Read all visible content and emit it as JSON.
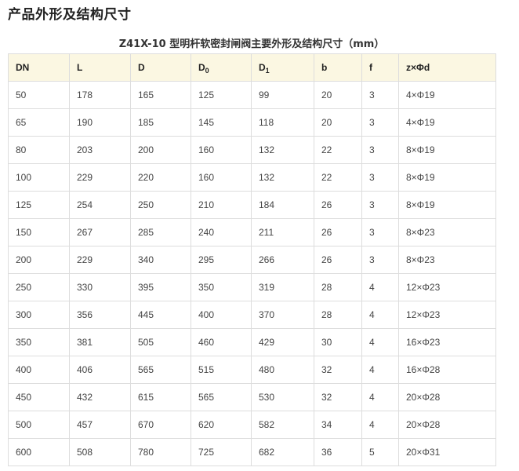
{
  "page": {
    "title": "产品外形及结构尺寸",
    "caption": "Z41X-10 型明杆软密封闸阀主要外形及结构尺寸（mm）"
  },
  "table": {
    "headers": [
      {
        "main": "DN",
        "sub": ""
      },
      {
        "main": "L",
        "sub": ""
      },
      {
        "main": "D",
        "sub": ""
      },
      {
        "main": "D",
        "sub": "0"
      },
      {
        "main": "D",
        "sub": "1"
      },
      {
        "main": "b",
        "sub": ""
      },
      {
        "main": "f",
        "sub": ""
      },
      {
        "main": "z×Φd",
        "sub": ""
      }
    ],
    "rows": [
      [
        "50",
        "178",
        "165",
        "125",
        "99",
        "20",
        "3",
        "4×Φ19"
      ],
      [
        "65",
        "190",
        "185",
        "145",
        "118",
        "20",
        "3",
        "4×Φ19"
      ],
      [
        "80",
        "203",
        "200",
        "160",
        "132",
        "22",
        "3",
        "8×Φ19"
      ],
      [
        "100",
        "229",
        "220",
        "160",
        "132",
        "22",
        "3",
        "8×Φ19"
      ],
      [
        "125",
        "254",
        "250",
        "210",
        "184",
        "26",
        "3",
        "8×Φ19"
      ],
      [
        "150",
        "267",
        "285",
        "240",
        "211",
        "26",
        "3",
        "8×Φ23"
      ],
      [
        "200",
        "229",
        "340",
        "295",
        "266",
        "26",
        "3",
        "8×Φ23"
      ],
      [
        "250",
        "330",
        "395",
        "350",
        "319",
        "28",
        "4",
        "12×Φ23"
      ],
      [
        "300",
        "356",
        "445",
        "400",
        "370",
        "28",
        "4",
        "12×Φ23"
      ],
      [
        "350",
        "381",
        "505",
        "460",
        "429",
        "30",
        "4",
        "16×Φ23"
      ],
      [
        "400",
        "406",
        "565",
        "515",
        "480",
        "32",
        "4",
        "16×Φ28"
      ],
      [
        "450",
        "432",
        "615",
        "565",
        "530",
        "32",
        "4",
        "20×Φ28"
      ],
      [
        "500",
        "457",
        "670",
        "620",
        "582",
        "34",
        "4",
        "20×Φ28"
      ],
      [
        "600",
        "508",
        "780",
        "725",
        "682",
        "36",
        "5",
        "20×Φ31"
      ]
    ]
  }
}
